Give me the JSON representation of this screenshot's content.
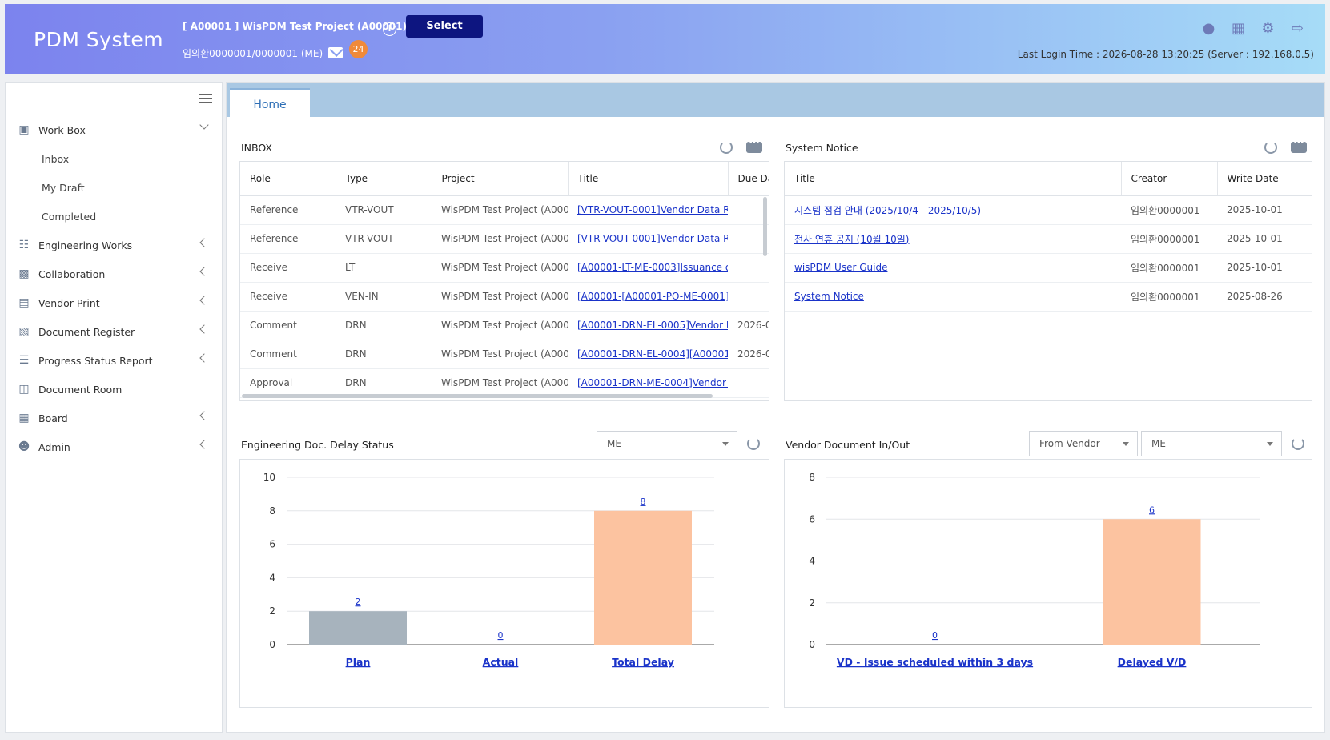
{
  "header": {
    "logo": "PDM System",
    "project": "[ A00001 ] WisPDM Test Project (A00001)",
    "select_label": "Select",
    "user": "임의환0000001/0000001 (ME)",
    "mail_count": "24",
    "last_login": "Last Login Time : 2026-08-28 13:20:25 (Server : 192.168.0.5)"
  },
  "sidebar": {
    "items": [
      {
        "label": "Work Box",
        "icon": "basket-icon"
      },
      {
        "label": "Engineering Works",
        "icon": "sitemap-icon"
      },
      {
        "label": "Collaboration",
        "icon": "briefcase-icon"
      },
      {
        "label": "Vendor Print",
        "icon": "document-icon"
      },
      {
        "label": "Document Register",
        "icon": "register-icon"
      },
      {
        "label": "Progress Status Report",
        "icon": "report-icon"
      },
      {
        "label": "Document Room",
        "icon": "room-icon"
      },
      {
        "label": "Board",
        "icon": "board-icon"
      },
      {
        "label": "Admin",
        "icon": "admin-icon"
      }
    ],
    "workbox_sub": [
      "Inbox",
      "My Draft",
      "Completed"
    ]
  },
  "tabs": {
    "home": "Home"
  },
  "inbox": {
    "title": "INBOX",
    "columns": [
      "Role",
      "Type",
      "Project",
      "Title",
      "Due Da"
    ],
    "rows": [
      [
        "Reference",
        "VTR-VOUT",
        "WisPDM Test Project (A0000",
        "[VTR-VOUT-0001]Vendor Data Re",
        ""
      ],
      [
        "Reference",
        "VTR-VOUT",
        "WisPDM Test Project (A0000",
        "[VTR-VOUT-0001]Vendor Data Re",
        ""
      ],
      [
        "Receive",
        "LT",
        "WisPDM Test Project (A0000",
        "[A00001-LT-ME-0003]Issuance of",
        ""
      ],
      [
        "Receive",
        "VEN-IN",
        "WisPDM Test Project (A0000",
        "[A00001-[A00001-PO-ME-0001]-IN",
        ""
      ],
      [
        "Comment",
        "DRN",
        "WisPDM Test Project (A0000",
        "[A00001-DRN-EL-0005]Vendor Da",
        "2026-0"
      ],
      [
        "Comment",
        "DRN",
        "WisPDM Test Project (A0000",
        "[A00001-DRN-EL-0004][A00001-D",
        "2026-0"
      ],
      [
        "Approval",
        "DRN",
        "WisPDM Test Project (A0000",
        "[A00001-DRN-ME-0004]Vendor da",
        ""
      ]
    ]
  },
  "notice": {
    "title": "System Notice",
    "columns": [
      "Title",
      "Creator",
      "Write Date"
    ],
    "rows": [
      [
        "시스템 점검 안내 (2025/10/4 - 2025/10/5)",
        "임의환0000001",
        "2025-10-01"
      ],
      [
        "전사 연휴 공지 (10월 10일)",
        "임의환0000001",
        "2025-10-01"
      ],
      [
        "wisPDM User Guide",
        "임의환0000001",
        "2025-10-01"
      ],
      [
        "System Notice",
        "임의환0000001",
        "2025-08-26"
      ]
    ]
  },
  "delay": {
    "title": "Engineering Doc. Delay Status",
    "filter": "ME"
  },
  "vendor": {
    "title": "Vendor Document In/Out",
    "filter1": "From Vendor",
    "filter2": "ME"
  },
  "chart_data": [
    {
      "type": "bar",
      "categories": [
        "Plan",
        "Actual",
        "Total Delay"
      ],
      "values": [
        2,
        0,
        8
      ],
      "colors": [
        "#a7b3bd",
        "#a7b3bd",
        "#fcc3a0"
      ],
      "ylim": [
        0,
        10
      ],
      "yticks": [
        0,
        2,
        4,
        6,
        8,
        10
      ],
      "title": "",
      "xlabel": "",
      "ylabel": "",
      "grid": true
    },
    {
      "type": "bar",
      "categories": [
        "VD - Issue scheduled within 3 days",
        "Delayed V/D"
      ],
      "values": [
        0,
        6
      ],
      "colors": [
        "#a7b3bd",
        "#fcc3a0"
      ],
      "ylim": [
        0,
        8
      ],
      "yticks": [
        0,
        2,
        4,
        6,
        8
      ],
      "title": "",
      "xlabel": "",
      "ylabel": "",
      "grid": true
    }
  ]
}
